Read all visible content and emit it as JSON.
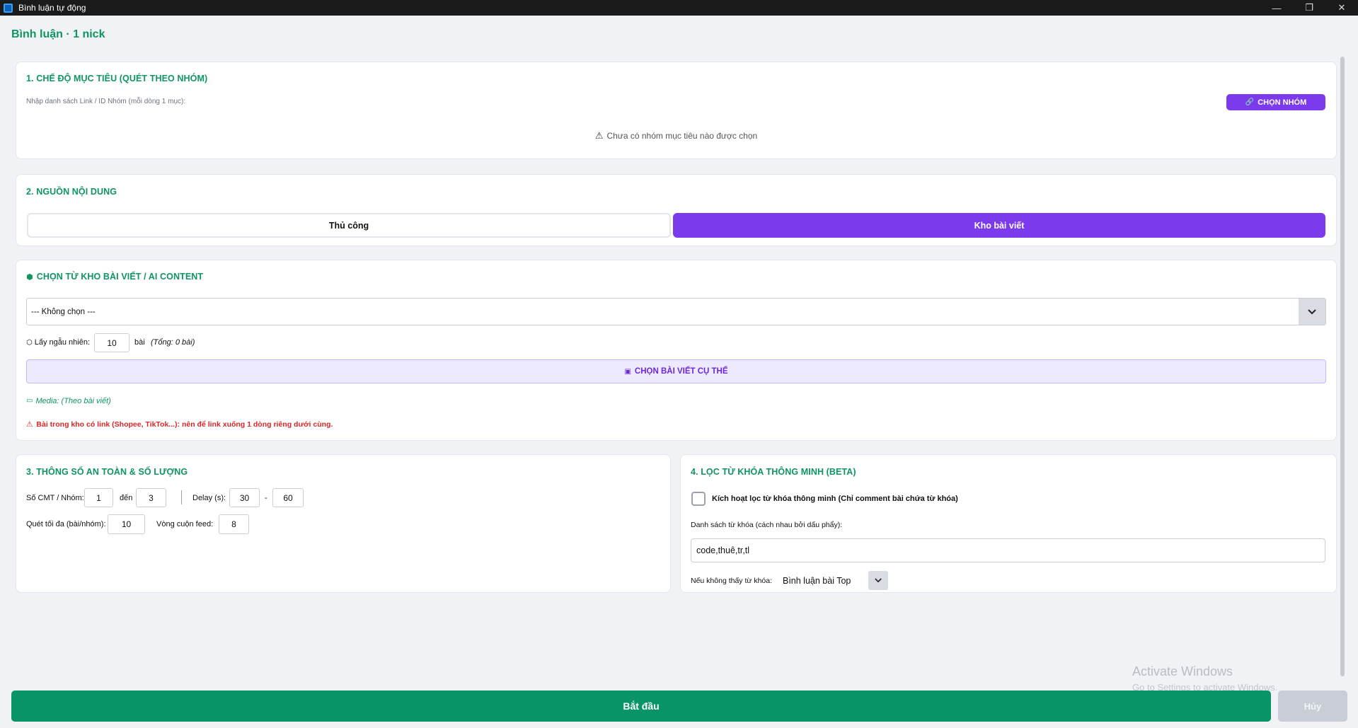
{
  "window": {
    "title": "Bình luận tự động",
    "minimize": "—",
    "restore": "❐",
    "close": "✕"
  },
  "header": {
    "title": "Bình luận · 1 nick"
  },
  "section1": {
    "title": "1. CHẾ ĐỘ MỤC TIÊU (QUÉT THEO NHÓM)",
    "input_label": "Nhập danh sách Link / ID Nhóm (mỗi dòng 1 mục):",
    "choose_group_button": "CHỌN NHÓM",
    "empty_notice": "Chưa có nhóm mục tiêu nào được chọn"
  },
  "section2": {
    "title": "2. NGUỒN NỘI DUNG",
    "tabs": [
      {
        "label": "Thủ công",
        "active": false
      },
      {
        "label": "Kho bài viết",
        "active": true
      }
    ]
  },
  "library": {
    "title": "CHỌN TỪ KHO BÀI VIẾT / AI CONTENT",
    "select_value": "--- Không chọn ---",
    "random_label": "Lấy ngẫu nhiên:",
    "random_value": "10",
    "random_unit": "bài",
    "total_text": "(Tổng: 0 bài)",
    "choose_posts_button": "CHỌN BÀI VIẾT CỤ THỂ",
    "media_text": "Media: (Theo bài viết)",
    "warning_text": "Bài trong kho có link (Shopee, TikTok...): nên để link xuống 1 dòng riêng dưới cùng."
  },
  "section3": {
    "title": "3. THÔNG SỐ AN TOÀN & SỐ LƯỢNG",
    "cmt_label": "Số CMT / Nhóm:",
    "cmt_min": "1",
    "cmt_to": "đến",
    "cmt_max": "3",
    "delay_label": "Delay (s):",
    "delay_min": "30",
    "delay_dash": "-",
    "delay_max": "60",
    "scan_label": "Quét tối đa (bài/nhóm):",
    "scan_value": "10",
    "scroll_label": "Vòng cuộn feed:",
    "scroll_value": "8"
  },
  "section4": {
    "title": "4. LỌC TỪ KHÓA THÔNG MINH (BETA)",
    "enable_label": "Kích hoạt lọc từ khóa thông minh (Chỉ comment bài chứa từ khóa)",
    "enabled": false,
    "keywords_label": "Danh sách từ khóa (cách nhau bởi dấu phẩy):",
    "keywords_value": "code,thuê,tr,tl",
    "fallback_label": "Nếu không thấy từ khóa:",
    "fallback_value": "Bình luận bài Top"
  },
  "footer": {
    "start_button": "Bắt đầu",
    "cancel_button": "Hủy"
  },
  "watermark": {
    "line1": "Activate Windows",
    "line2": "Go to Settings to activate Windows."
  },
  "colors": {
    "accent_green": "#0e9560",
    "purple": "#7c3aed",
    "warning_red": "#dc2626"
  }
}
